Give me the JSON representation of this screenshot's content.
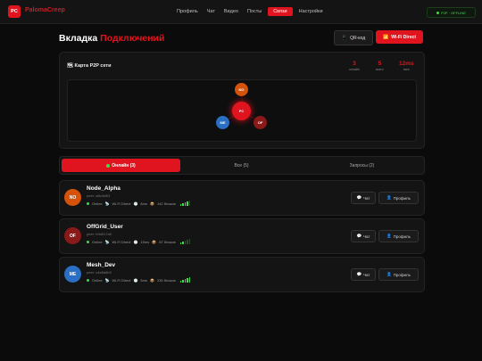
{
  "app": {
    "logo_text": "PC",
    "brand": "PalomaCreep"
  },
  "nav": {
    "items": [
      {
        "label": "Профиль"
      },
      {
        "label": "Чат"
      },
      {
        "label": "Видео"
      },
      {
        "label": "Посты"
      },
      {
        "label": "Связи"
      },
      {
        "label": "Настройки"
      }
    ],
    "active_index": 4,
    "status": "P2P · OFFLINE"
  },
  "header": {
    "title_main": "Вкладка ",
    "title_accent": "Подключений",
    "qr_button": "QR-код",
    "qr_icon": "📱",
    "wifi_button": "Wi-Fi Direct",
    "wifi_icon": "📶"
  },
  "map": {
    "title_icon": "🗺",
    "title": "Карта P2P сети",
    "stats": [
      {
        "value": "3",
        "label": "онлайн"
      },
      {
        "value": "5",
        "label": "всего"
      },
      {
        "value": "12ms",
        "label": "пинг"
      }
    ],
    "center_node": "PC",
    "nodes": [
      {
        "label": "NO",
        "color": "#d4520a"
      },
      {
        "label": "ME",
        "color": "#2a6fc4"
      },
      {
        "label": "OF",
        "color": "#8a1a1a"
      }
    ]
  },
  "tabs": [
    {
      "label": "Онлайн (3)",
      "active": true
    },
    {
      "label": "Все (5)",
      "active": false
    },
    {
      "label": "Запросы (2)",
      "active": false
    }
  ],
  "peers": [
    {
      "initials": "NO",
      "color": "#d4520a",
      "name": "Node_Alpha",
      "id": "peer: a8c4e8f1",
      "status": "Online",
      "link": "Wi-Fi Direct",
      "ping": "8ms",
      "blocks": "142 блоков",
      "signal": 4,
      "chat": "Чат",
      "profile": "Профиль"
    },
    {
      "initials": "OF",
      "color": "#8a1a1a",
      "name": "OffGrid_User",
      "id": "peer: b9d917a0",
      "status": "Online",
      "link": "Wi-Fi Direct",
      "ping": "19ms",
      "blocks": "67 блоков",
      "signal": 2,
      "chat": "Чат",
      "profile": "Профиль"
    },
    {
      "initials": "ME",
      "color": "#2a6fc4",
      "name": "Mesh_Dev",
      "id": "peer: c4e8a6b2",
      "status": "Online",
      "link": "Wi-Fi Direct",
      "ping": "5ms",
      "blocks": "230 блоков",
      "signal": 5,
      "chat": "Чат",
      "profile": "Профиль"
    }
  ],
  "colors": {
    "accent": "#e0141e",
    "online": "#3ddc4a"
  },
  "icons": {
    "chat": "💬",
    "profile": "👤",
    "wifi": "📡",
    "clock": "🕒",
    "blocks": "📦",
    "online": "🟢"
  }
}
